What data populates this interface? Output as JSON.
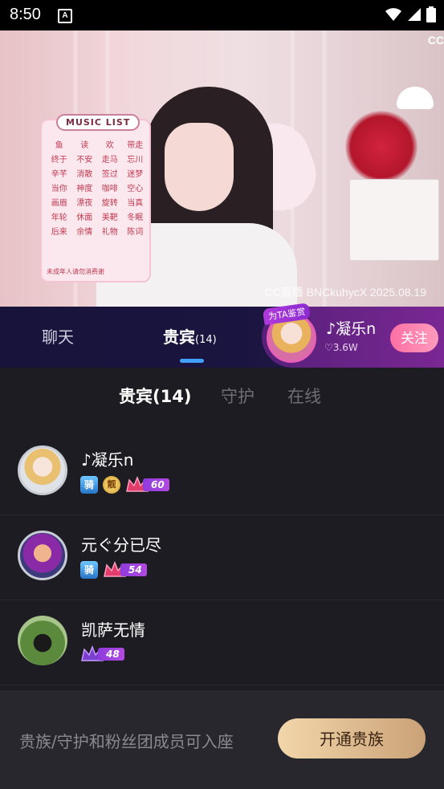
{
  "status_bar": {
    "time": "8:50",
    "notification_icon": "A"
  },
  "video": {
    "music_list_title": "MUSIC LIST",
    "music_items": [
      "鱼",
      "读",
      "欢",
      "带走",
      "终于",
      "不安",
      "走马",
      "忘川",
      "辛芊",
      "消散",
      "签过",
      "迷梦",
      "当你",
      "神度",
      "咖啡",
      "空心",
      "画眉",
      "漂夜",
      "旋转",
      "当真",
      "年轮",
      "休面",
      "美靶",
      "冬眠",
      "后来",
      "余情",
      "礼物",
      "陈词"
    ],
    "music_footer": "未成年人请勿消费谢",
    "logo": "CC",
    "watermark": "CC直播 BNCkuhycX 2025.08.19"
  },
  "tabs": {
    "chat": "聊天",
    "guests": "贵宾",
    "guests_count": "(14)"
  },
  "recommend": {
    "badge": "为TA鉴赏",
    "name": "♪凝乐n",
    "fans": "3.6W",
    "follow_label": "关注"
  },
  "subtabs": {
    "guests": "贵宾(14)",
    "guard": "守护",
    "online": "在线"
  },
  "guests": [
    {
      "name": "♪凝乐n",
      "knight": "骑",
      "handsome": "靓",
      "level": "60"
    },
    {
      "name": "元ぐ分已尽",
      "knight": "骑",
      "level": "54"
    },
    {
      "name": "凯萨无情",
      "level": "48"
    }
  ],
  "footer": {
    "text": "贵族/守护和粉丝团成员可入座",
    "button": "开通贵族"
  }
}
